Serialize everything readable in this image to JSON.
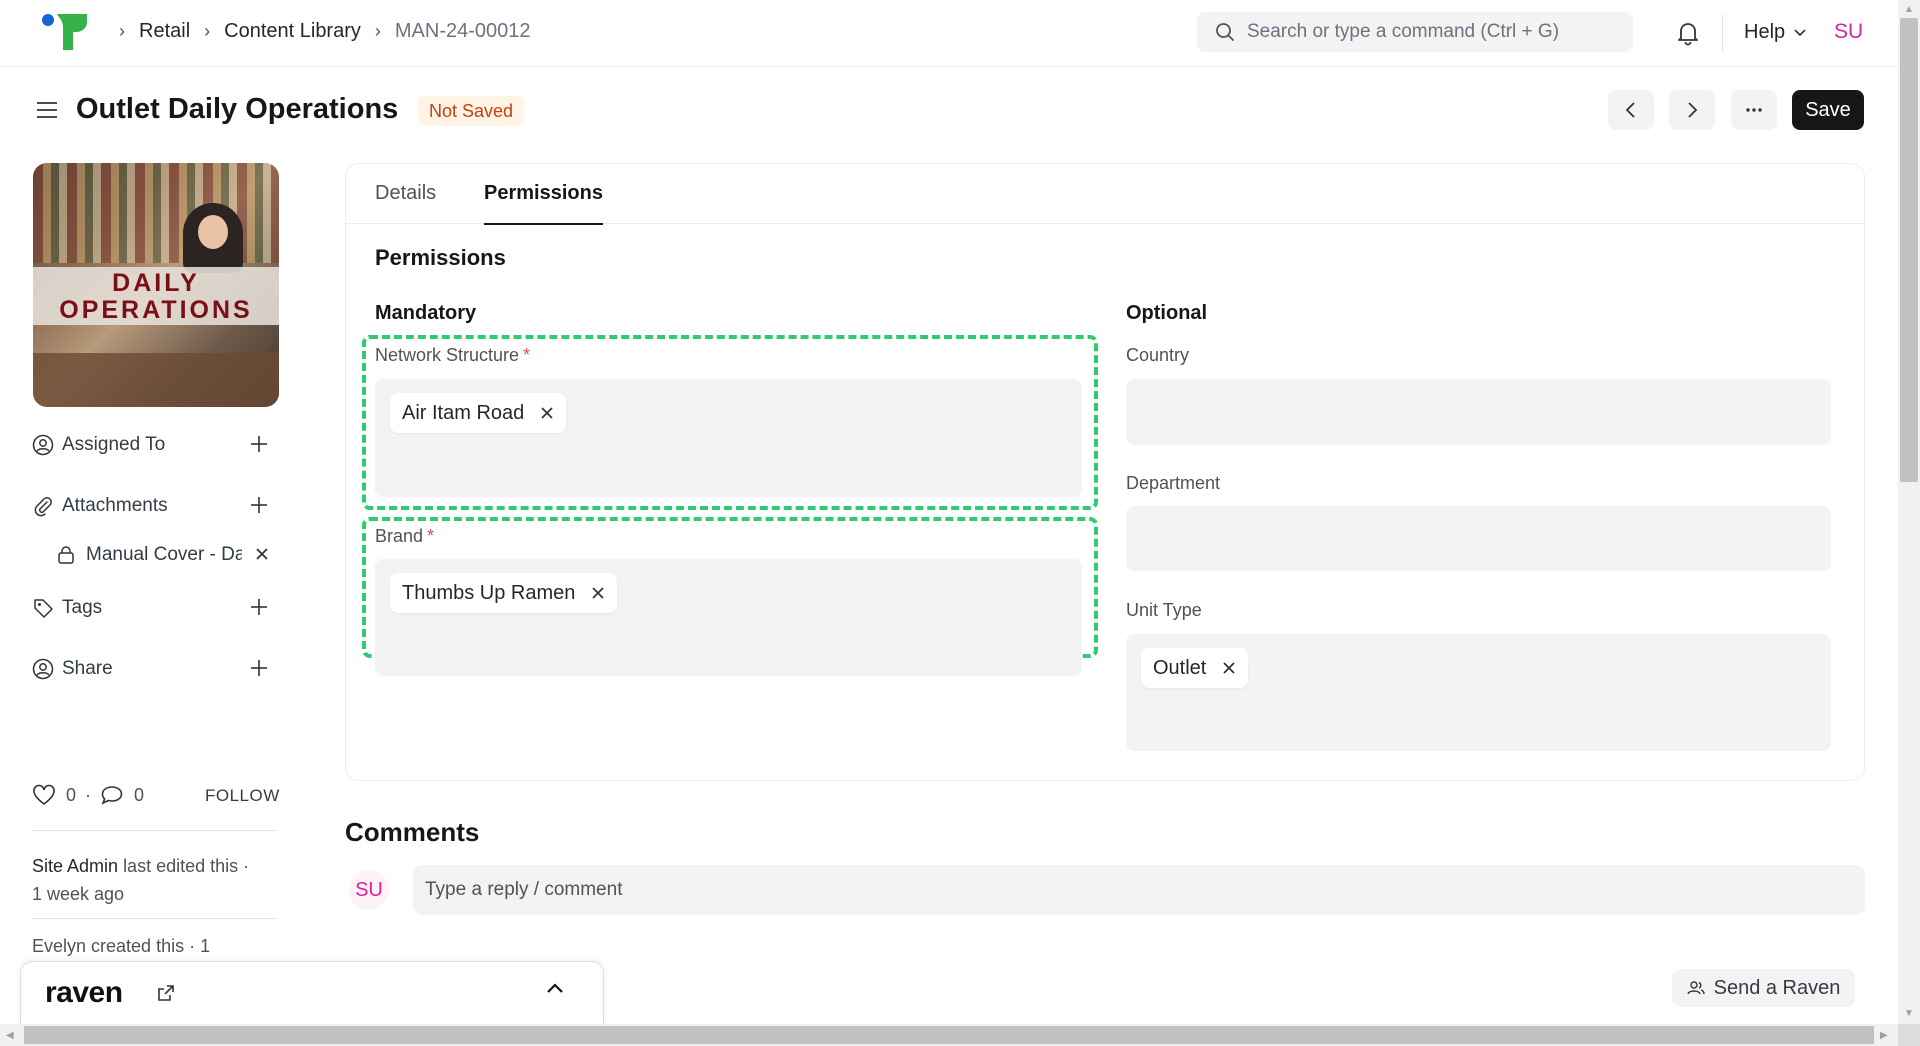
{
  "navbar": {
    "breadcrumbs": [
      "Retail",
      "Content Library",
      "MAN-24-00012"
    ],
    "search_placeholder": "Search or type a command (Ctrl + G)",
    "help_label": "Help",
    "user_initials": "SU"
  },
  "page": {
    "title": "Outlet Daily Operations",
    "status": "Not Saved",
    "save_label": "Save"
  },
  "sidebar": {
    "cover_text_line1": "DAILY",
    "cover_text_line2": "OPERATIONS",
    "assigned_to": "Assigned To",
    "attachments": "Attachments",
    "attachment_file": "Manual Cover - Daily Operations",
    "tags": "Tags",
    "share": "Share",
    "likes": "0",
    "comments_count": "0",
    "follow_label": "FOLLOW",
    "activity_editor": "Site Admin",
    "activity_edit_text": "last edited this ·",
    "activity_edit_time": "1 week ago",
    "activity_created": "Evelyn created this · 1"
  },
  "tabs": [
    "Details",
    "Permissions"
  ],
  "permissions": {
    "section_title": "Permissions",
    "mandatory_title": "Mandatory",
    "optional_title": "Optional",
    "network_structure_label": "Network Structure",
    "network_structure_value": "Air Itam Road",
    "brand_label": "Brand",
    "brand_value": "Thumbs Up Ramen",
    "country_label": "Country",
    "department_label": "Department",
    "unit_type_label": "Unit Type",
    "unit_type_value": "Outlet",
    "required_marker": "*"
  },
  "comments": {
    "title": "Comments",
    "avatar_initials": "SU",
    "placeholder": "Type a reply / comment"
  },
  "raven": {
    "logo": "raven",
    "send_label": "Send a Raven"
  },
  "colors": {
    "accent": "#171717",
    "highlight_dashed": "#2ecc71",
    "status_badge": "#c2410c",
    "avatar": "#d6249f"
  }
}
